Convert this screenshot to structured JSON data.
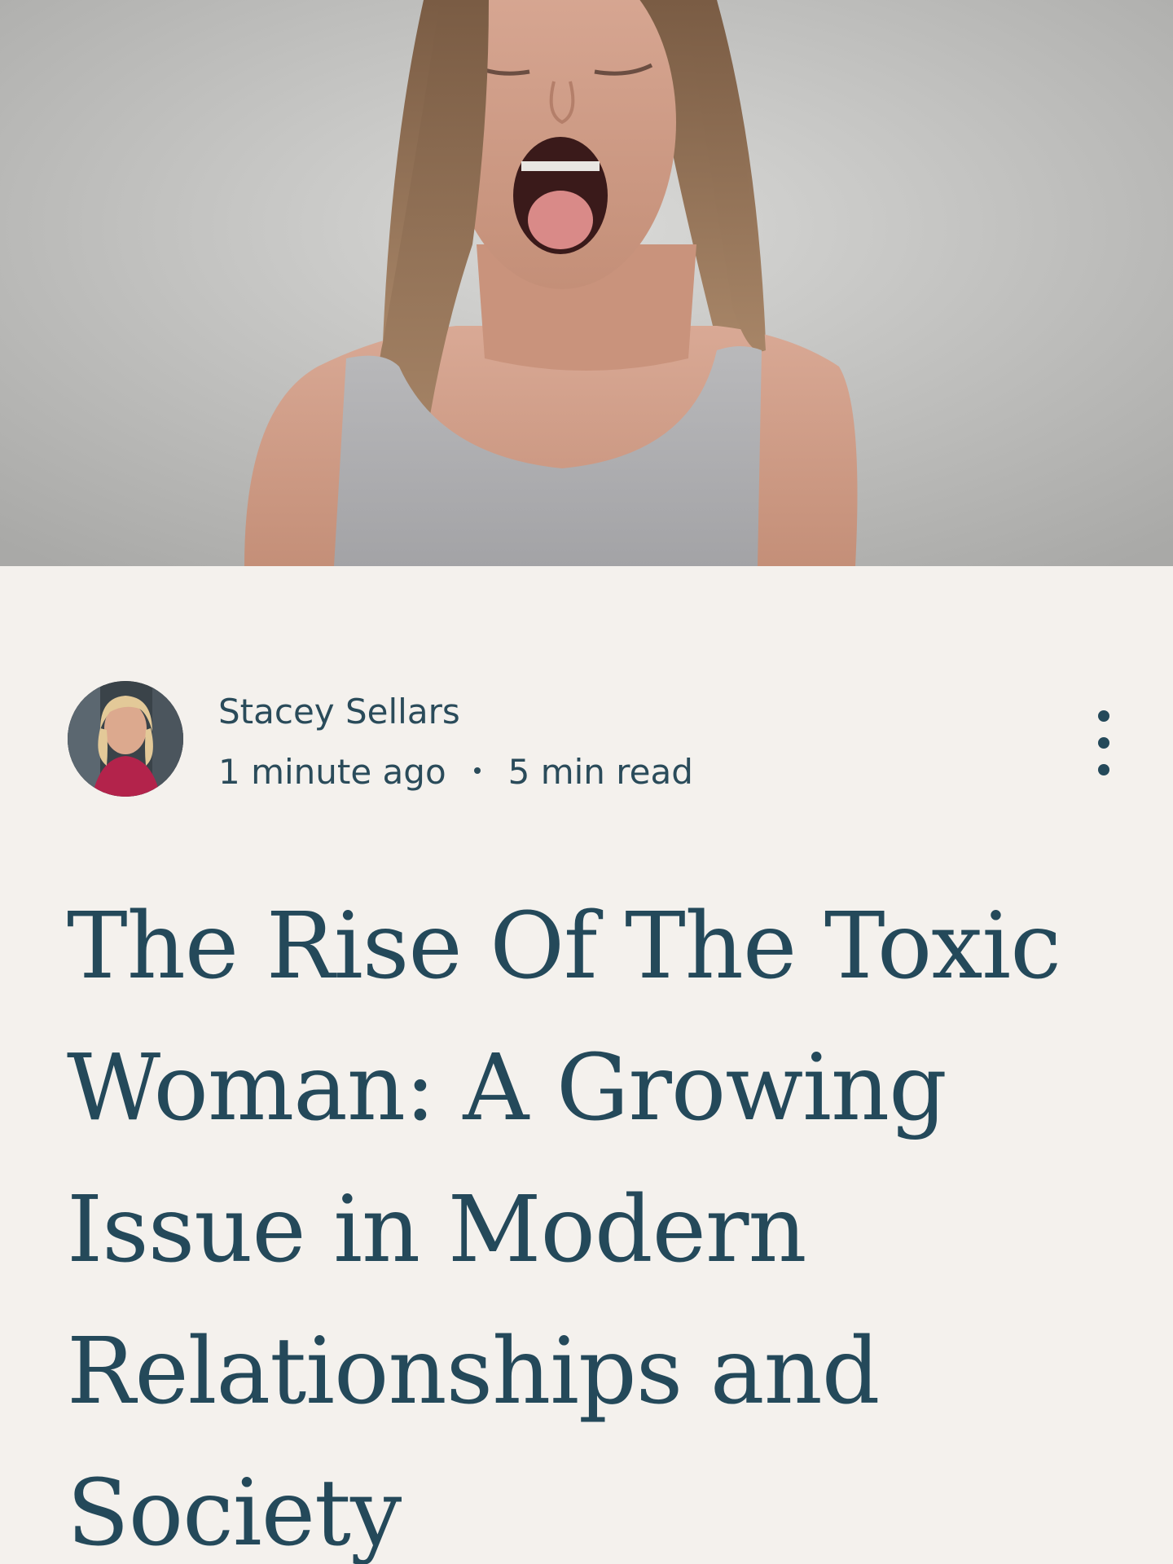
{
  "hero": {
    "image_icon": "photo-woman-screaming"
  },
  "post": {
    "author": {
      "name": "Stacey Sellars",
      "avatar_icon": "author-avatar-photo"
    },
    "meta": {
      "published": "1 minute ago",
      "separator_icon": "dot-separator",
      "read_time": "5 min read"
    },
    "more_icon": "more-vertical-icon",
    "title": "The Rise Of The Toxic Woman: A Growing Issue in Modern Relationships and Society"
  },
  "colors": {
    "background": "#f4f1ed",
    "text": "#24495a"
  }
}
